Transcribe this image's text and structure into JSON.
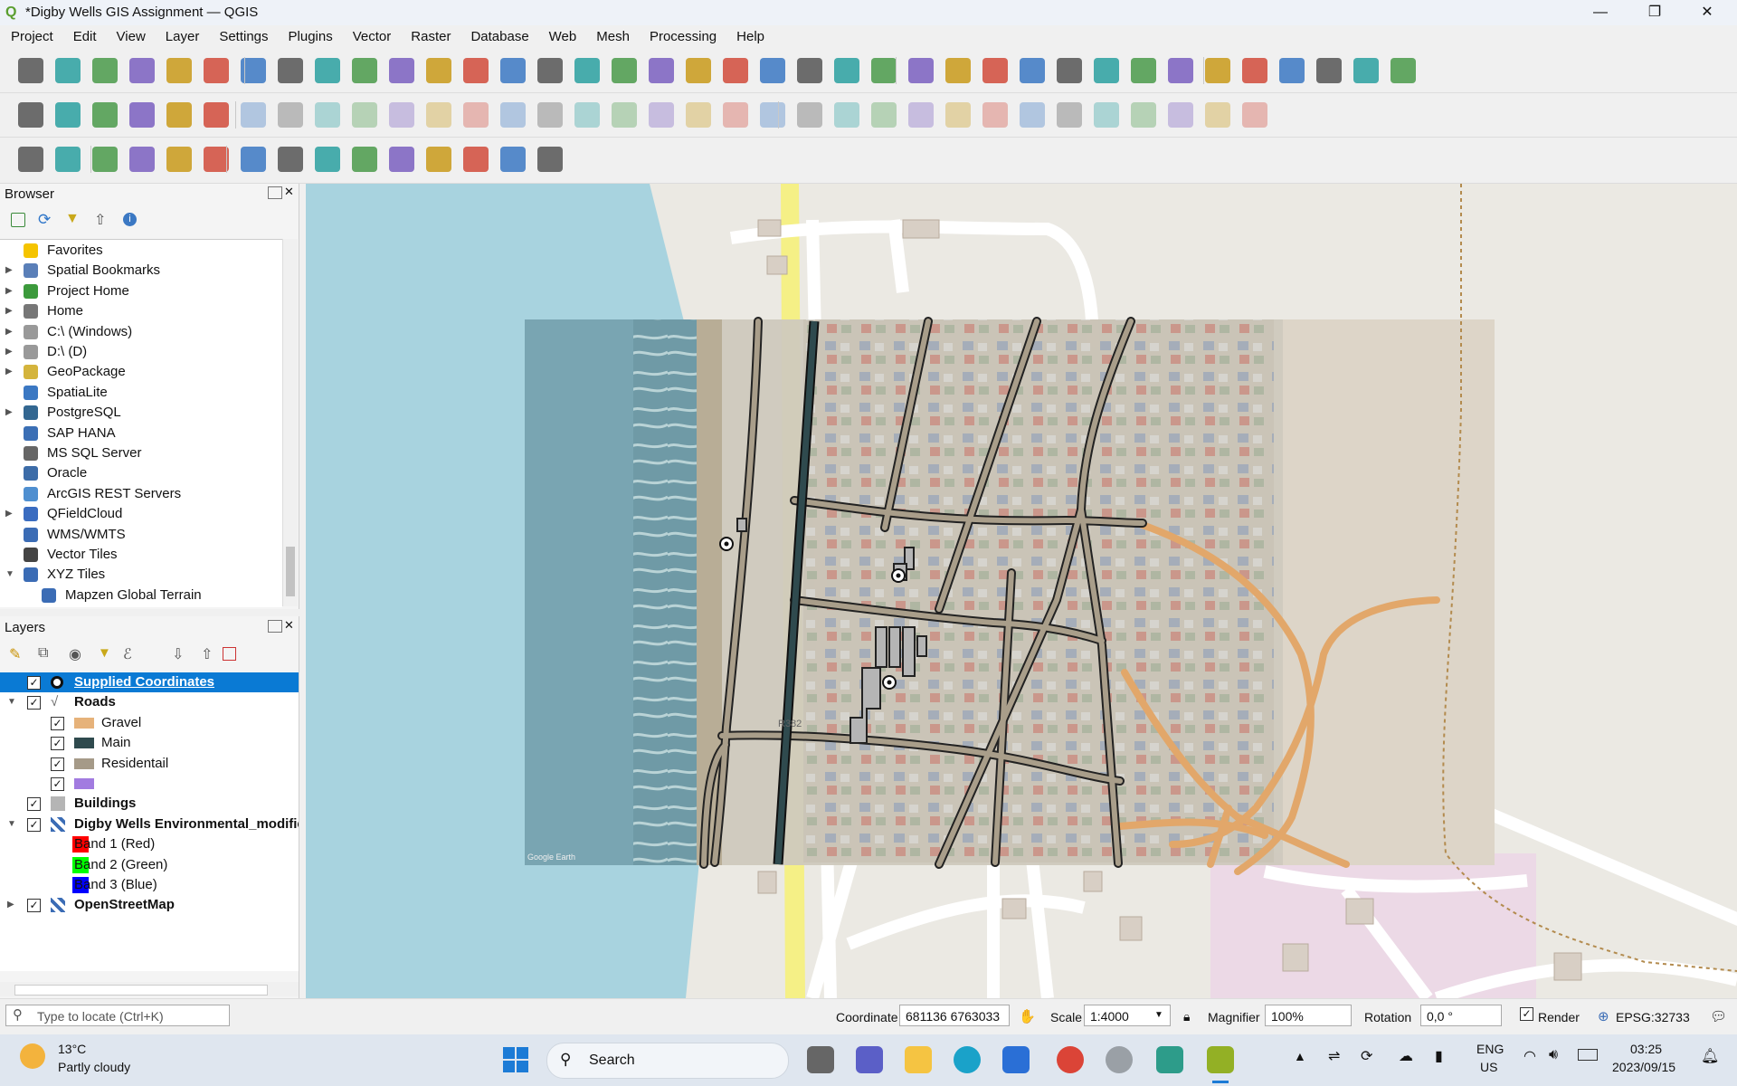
{
  "window": {
    "title": "*Digby Wells GIS Assignment — QGIS",
    "min": "—",
    "max": "❐",
    "close": "✕"
  },
  "menu": [
    "Project",
    "Edit",
    "View",
    "Layer",
    "Settings",
    "Plugins",
    "Vector",
    "Raster",
    "Database",
    "Web",
    "Mesh",
    "Processing",
    "Help"
  ],
  "browser": {
    "title": "Browser",
    "items": [
      {
        "label": "Favorites",
        "icon": "star-icon",
        "color": "#f5c400",
        "arrow": ""
      },
      {
        "label": "Spatial Bookmarks",
        "icon": "bookmark-icon",
        "color": "#5a7fb8",
        "arrow": "▶"
      },
      {
        "label": "Project Home",
        "icon": "project-home-icon",
        "color": "#3c9a3c",
        "arrow": "▶"
      },
      {
        "label": "Home",
        "icon": "home-icon",
        "color": "#777777",
        "arrow": "▶"
      },
      {
        "label": "C:\\ (Windows)",
        "icon": "drive-icon",
        "color": "#999999",
        "arrow": "▶"
      },
      {
        "label": "D:\\ (D)",
        "icon": "drive-icon",
        "color": "#999999",
        "arrow": "▶"
      },
      {
        "label": "GeoPackage",
        "icon": "geopackage-icon",
        "color": "#d4b43c",
        "arrow": "▶"
      },
      {
        "label": "SpatiaLite",
        "icon": "spatialite-icon",
        "color": "#3b78c3",
        "arrow": ""
      },
      {
        "label": "PostgreSQL",
        "icon": "postgresql-icon",
        "color": "#336791",
        "arrow": "▶"
      },
      {
        "label": "SAP HANA",
        "icon": "sap-hana-icon",
        "color": "#3b6fb5",
        "arrow": ""
      },
      {
        "label": "MS SQL Server",
        "icon": "mssql-icon",
        "color": "#666666",
        "arrow": ""
      },
      {
        "label": "Oracle",
        "icon": "oracle-icon",
        "color": "#3c6ca8",
        "arrow": ""
      },
      {
        "label": "ArcGIS REST Servers",
        "icon": "arcgis-icon",
        "color": "#4f8fd0",
        "arrow": ""
      },
      {
        "label": "QFieldCloud",
        "icon": "cloud-icon",
        "color": "#3a6cc0",
        "arrow": "▶"
      },
      {
        "label": "WMS/WMTS",
        "icon": "globe-icon",
        "color": "#3b6cb5",
        "arrow": ""
      },
      {
        "label": "Vector Tiles",
        "icon": "grid-icon",
        "color": "#444444",
        "arrow": ""
      },
      {
        "label": "XYZ Tiles",
        "icon": "grid-icon",
        "color": "#3b6cb5",
        "arrow": "▼"
      },
      {
        "label": "Mapzen Global Terrain",
        "icon": "grid-icon",
        "color": "#3b6cb5",
        "arrow": ""
      }
    ]
  },
  "layers": {
    "title": "Layers",
    "items": [
      {
        "label": "Supplied Coordinates",
        "indent": 0,
        "arrow": "",
        "checked": "✓",
        "swatch": "#ffffff",
        "bold": true,
        "selected": true
      },
      {
        "label": "Roads",
        "indent": 0,
        "arrow": "▼",
        "checked": "✓",
        "swatch": "",
        "bold": true,
        "selected": false
      },
      {
        "label": "Gravel",
        "indent": 1,
        "arrow": "",
        "checked": "✓",
        "swatch": "#e6b27a",
        "bold": false,
        "selected": false
      },
      {
        "label": "Main",
        "indent": 1,
        "arrow": "",
        "checked": "✓",
        "swatch": "#2f4a4e",
        "bold": false,
        "selected": false
      },
      {
        "label": "Residentail",
        "indent": 1,
        "arrow": "",
        "checked": "✓",
        "swatch": "#a59a88",
        "bold": false,
        "selected": false
      },
      {
        "label": "",
        "indent": 1,
        "arrow": "",
        "checked": "✓",
        "swatch": "#a27be0",
        "bold": false,
        "selected": false
      },
      {
        "label": "Buildings",
        "indent": 0,
        "arrow": "",
        "checked": "✓",
        "swatch": "#b5b5b5",
        "bold": true,
        "selected": false
      },
      {
        "label": "Digby Wells Environmental_modifie",
        "indent": 0,
        "arrow": "▼",
        "checked": "✓",
        "swatch": "",
        "bold": true,
        "selected": false
      },
      {
        "label": "Band 1 (Red)",
        "indent": 2,
        "arrow": "",
        "checked": "",
        "swatch": "#ff0000",
        "bold": false,
        "selected": false
      },
      {
        "label": "Band 2 (Green)",
        "indent": 2,
        "arrow": "",
        "checked": "",
        "swatch": "#00ff00",
        "bold": false,
        "selected": false
      },
      {
        "label": "Band 3 (Blue)",
        "indent": 2,
        "arrow": "",
        "checked": "",
        "swatch": "#0000ff",
        "bold": false,
        "selected": false
      },
      {
        "label": "OpenStreetMap",
        "indent": 0,
        "arrow": "▶",
        "checked": "✓",
        "swatch": "",
        "bold": true,
        "selected": false
      }
    ]
  },
  "map_labels": {
    "road_number": "R382",
    "watermark": "Google Earth"
  },
  "status": {
    "locate_placeholder": "Type to locate (Ctrl+K)",
    "coordinate_label": "Coordinate",
    "coordinate_value": "681136  6763033",
    "scale_label": "Scale",
    "scale_value": "1:4000",
    "magnifier_label": "Magnifier",
    "magnifier_value": "100%",
    "rotation_label": "Rotation",
    "rotation_value": "0,0 °",
    "render_label": "Render",
    "crs": "EPSG:32733"
  },
  "taskbar": {
    "weather_temp": "13°C",
    "weather_desc": "Partly cloudy",
    "search_label": "Search",
    "lang": "ENG",
    "region": "US",
    "time": "03:25",
    "date": "2023/09/15"
  }
}
